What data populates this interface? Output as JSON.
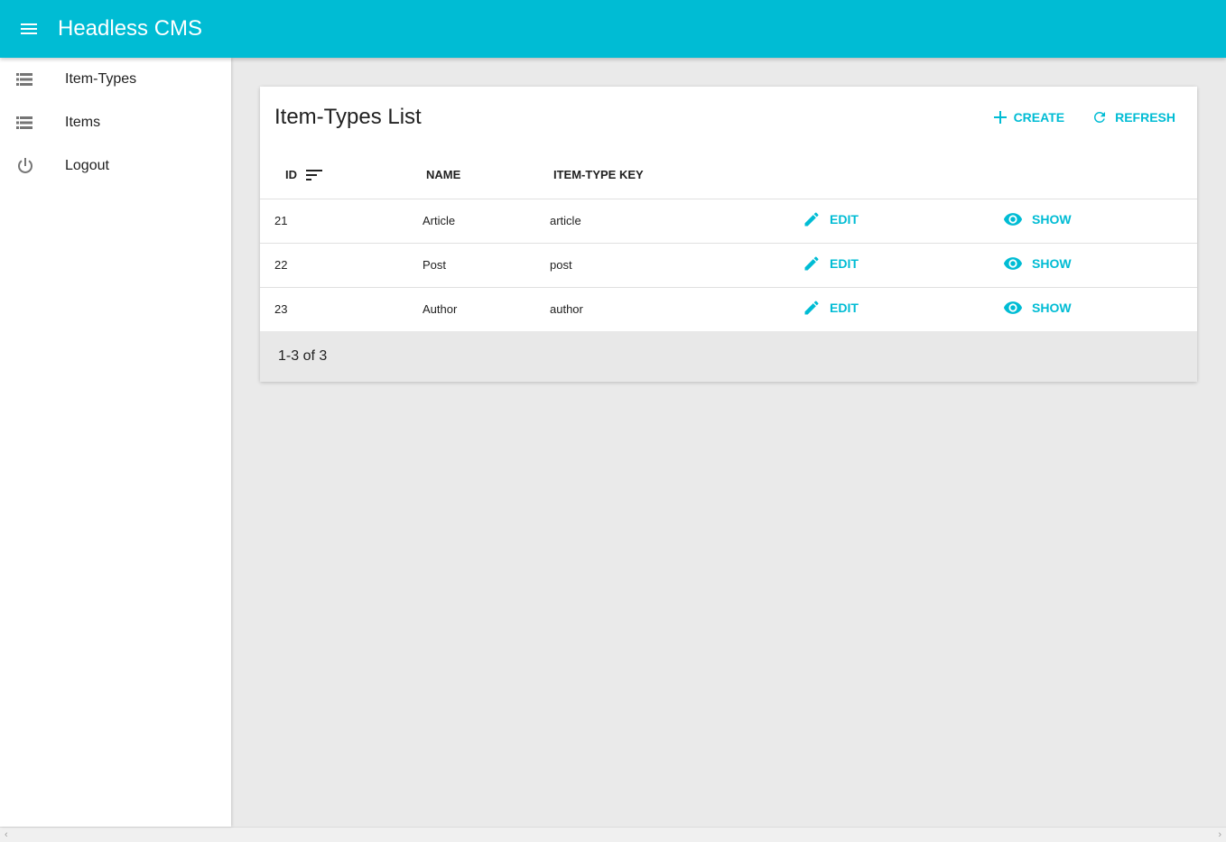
{
  "appbar": {
    "title": "Headless CMS",
    "menu_icon": "hamburger-menu-icon"
  },
  "sidebar": {
    "items": [
      {
        "label": "Item-Types",
        "icon": "list-icon"
      },
      {
        "label": "Items",
        "icon": "list-icon"
      },
      {
        "label": "Logout",
        "icon": "power-icon"
      }
    ]
  },
  "card": {
    "title": "Item-Types List",
    "actions": {
      "create_label": "CREATE",
      "refresh_label": "REFRESH"
    },
    "accent": "#00bcd4"
  },
  "table": {
    "headers": {
      "id": "ID",
      "name": "NAME",
      "key": "ITEM-TYPE KEY"
    },
    "sorted_by": "ID",
    "rows": [
      {
        "id": "21",
        "name": "Article",
        "key": "article",
        "edit": "EDIT",
        "show": "SHOW"
      },
      {
        "id": "22",
        "name": "Post",
        "key": "post",
        "edit": "EDIT",
        "show": "SHOW"
      },
      {
        "id": "23",
        "name": "Author",
        "key": "author",
        "edit": "EDIT",
        "show": "SHOW"
      }
    ]
  },
  "pagination": {
    "text": "1-3 of 3"
  },
  "scrollbar": {
    "left_arrow": "‹",
    "right_arrow": "›"
  }
}
